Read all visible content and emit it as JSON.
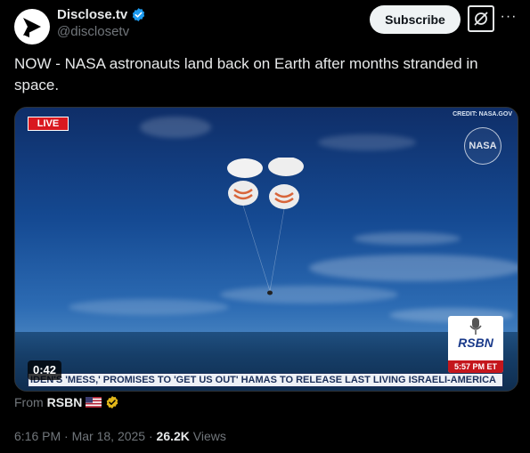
{
  "author": {
    "name": "Disclose.tv",
    "handle": "@disclosetv",
    "verified_icon": "verified-badge-icon",
    "accent": "#1d9bf0"
  },
  "actions": {
    "subscribe_label": "Subscribe",
    "grok_icon": "grok-icon",
    "more_label": "···"
  },
  "tweet": {
    "text": "NOW - NASA astronauts land back on Earth after months stranded in space."
  },
  "video": {
    "live_label": "LIVE",
    "credit": "CREDIT: NASA.GOV",
    "nasa_logo": "NASA",
    "duration": "0:42",
    "rsbn_label": "RSBN",
    "rsbn_time": "5:57 PM ET",
    "ticker": "IDEN'S 'MESS,' PROMISES TO 'GET US OUT'     HAMAS TO RELEASE LAST LIVING ISRAELI-AMERICA"
  },
  "source": {
    "prefix": "From",
    "name": "RSBN"
  },
  "meta": {
    "time": "6:16 PM",
    "date": "Mar 18, 2025",
    "views_count": "26.2K",
    "views_label": "Views"
  }
}
